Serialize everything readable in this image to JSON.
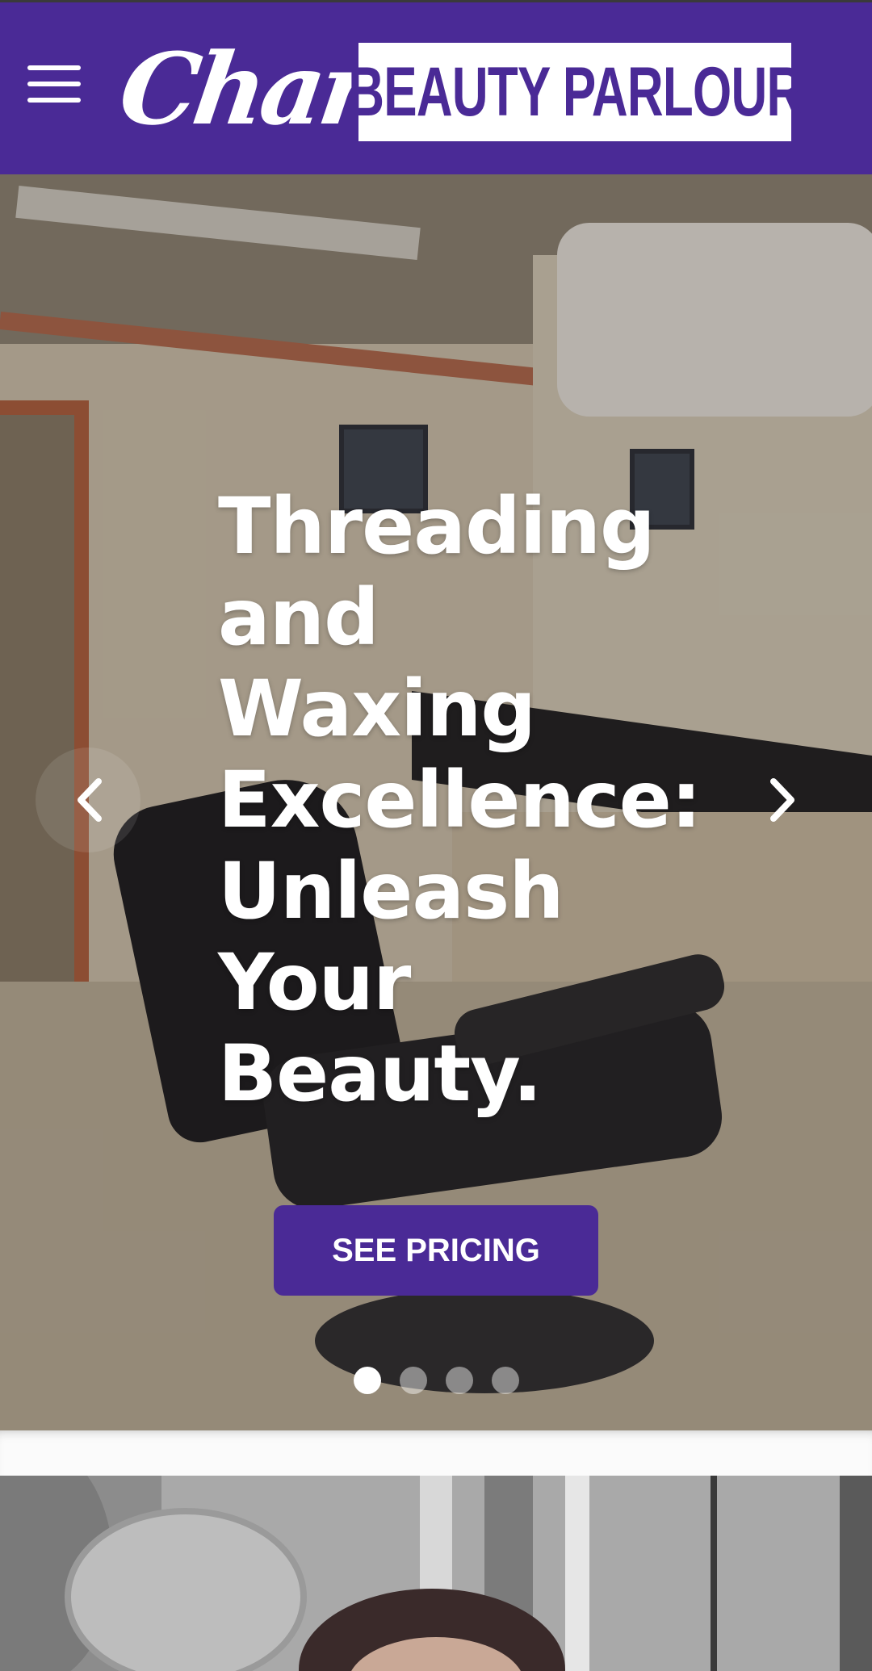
{
  "header": {
    "menu_label": "Menu",
    "logo_script": "Charm",
    "logo_box": "BEAUTY PARLOUR",
    "colors": {
      "brand": "#4a2a96",
      "text": "#ffffff"
    }
  },
  "hero": {
    "title_lines": [
      "Threading",
      "and",
      "Waxing",
      "Excellence:",
      "Unleash",
      "Your",
      "Beauty."
    ],
    "cta_label": "SEE PRICING",
    "prev_icon": "chevron-left-icon",
    "next_icon": "chevron-right-icon",
    "slides_total": 4,
    "active_slide": 1
  }
}
